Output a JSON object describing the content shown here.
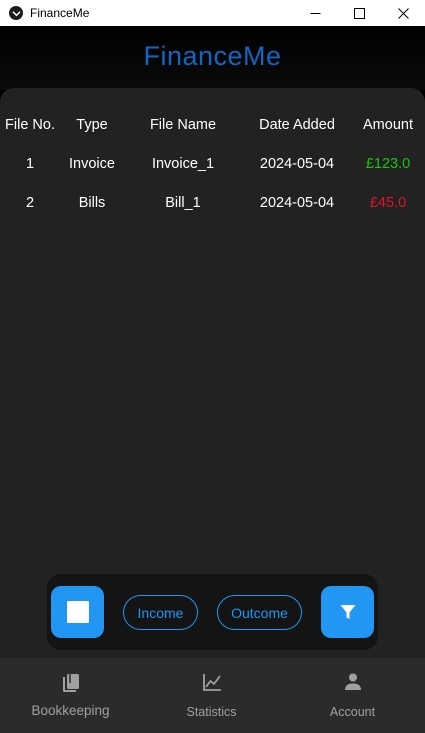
{
  "window": {
    "title": "FinanceMe",
    "controls": [
      "minimize-icon",
      "maximize-icon",
      "close-icon"
    ]
  },
  "header": {
    "app_name": "FinanceMe"
  },
  "table": {
    "columns": [
      "File No.",
      "Type",
      "File Name",
      "Date Added",
      "Amount"
    ],
    "rows": [
      {
        "no": "1",
        "type": "Invoice",
        "name": "Invoice_1",
        "date": "2024-05-04",
        "amount": "£123.0",
        "kind": "income"
      },
      {
        "no": "2",
        "type": "Bills",
        "name": "Bill_1",
        "date": "2024-05-04",
        "amount": "£45.0",
        "kind": "outcome"
      }
    ]
  },
  "actions": {
    "stop_icon": "stop-square-icon",
    "income_label": "Income",
    "outcome_label": "Outcome",
    "filter_icon": "filter-funnel-icon"
  },
  "nav": {
    "items": [
      {
        "label": "Bookkeeping",
        "icon": "book-icon",
        "active": true
      },
      {
        "label": "Statistics",
        "icon": "line-chart-icon",
        "active": false
      },
      {
        "label": "Account",
        "icon": "person-icon",
        "active": false
      }
    ]
  },
  "colors": {
    "accent": "#2196f3",
    "brand": "#1565c0",
    "income": "#16c60c",
    "outcome": "#e81123",
    "panel": "#222222",
    "nav_bg": "#2b2b2b"
  }
}
